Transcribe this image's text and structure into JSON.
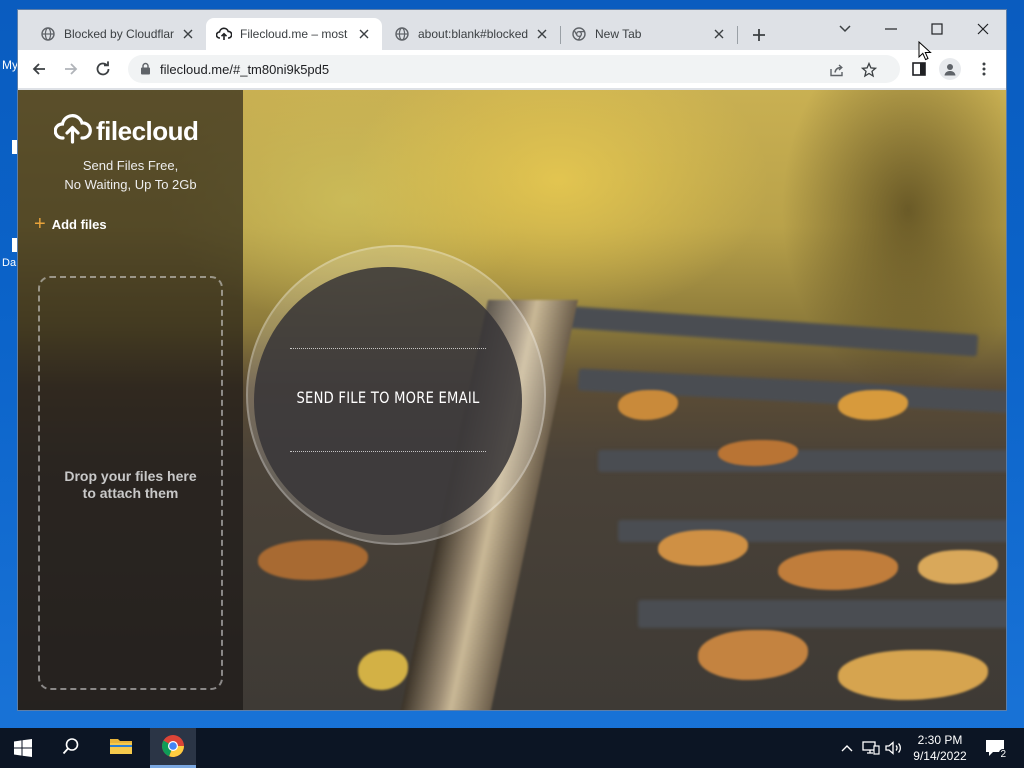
{
  "desktop": {
    "icon_label_1": "My",
    "icon_label_2": "Da"
  },
  "browser": {
    "tabs": [
      {
        "title": "Blocked by Cloudflare",
        "favicon": "globe-icon",
        "active": false
      },
      {
        "title": "Filecloud.me – most s",
        "favicon": "cloud-upload-icon",
        "active": true
      },
      {
        "title": "about:blank#blocked",
        "favicon": "globe-icon",
        "active": false
      },
      {
        "title": "New Tab",
        "favicon": "chrome-icon",
        "active": false
      }
    ],
    "address": "filecloud.me/#_tm80ni9k5pd5"
  },
  "page": {
    "logo_text": "filecloud",
    "tagline_line1": "Send Files Free,",
    "tagline_line2": "No Waiting, Up To 2Gb",
    "add_files_label": "Add files",
    "drop_line1": "Drop your files here",
    "drop_line2": "to attach them",
    "send_more_label": "SEND FILE TO MORE EMAIL",
    "accent_color": "#e8a33a"
  },
  "taskbar": {
    "time": "2:30 PM",
    "date": "9/14/2022",
    "notification_count": "2"
  }
}
